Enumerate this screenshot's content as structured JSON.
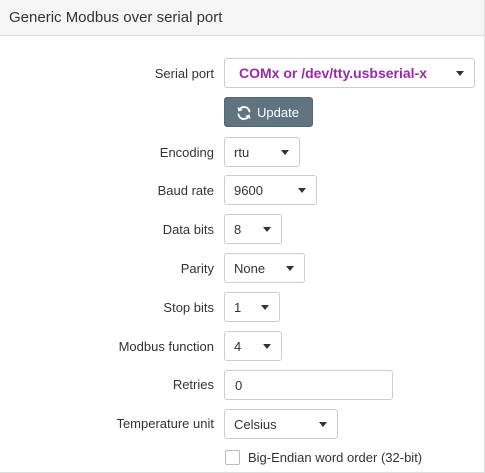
{
  "panel": {
    "title": "Generic Modbus over serial port"
  },
  "form": {
    "serial_port": {
      "label": "Serial port",
      "value": "COMx or /dev/tty.usbserial-x"
    },
    "update_button": {
      "label": "Update",
      "icon": "refresh-icon"
    },
    "encoding": {
      "label": "Encoding",
      "value": "rtu"
    },
    "baud_rate": {
      "label": "Baud rate",
      "value": "9600"
    },
    "data_bits": {
      "label": "Data bits",
      "value": "8"
    },
    "parity": {
      "label": "Parity",
      "value": "None"
    },
    "stop_bits": {
      "label": "Stop bits",
      "value": "1"
    },
    "modbus_function": {
      "label": "Modbus function",
      "value": "4"
    },
    "retries": {
      "label": "Retries",
      "value": "0"
    },
    "temperature_unit": {
      "label": "Temperature unit",
      "value": "Celsius"
    },
    "big_endian": {
      "label": "Big-Endian word order (32-bit)",
      "checked": false
    }
  },
  "colors": {
    "serial_value": "#9b2aa6",
    "update_button_bg": "#607480"
  }
}
